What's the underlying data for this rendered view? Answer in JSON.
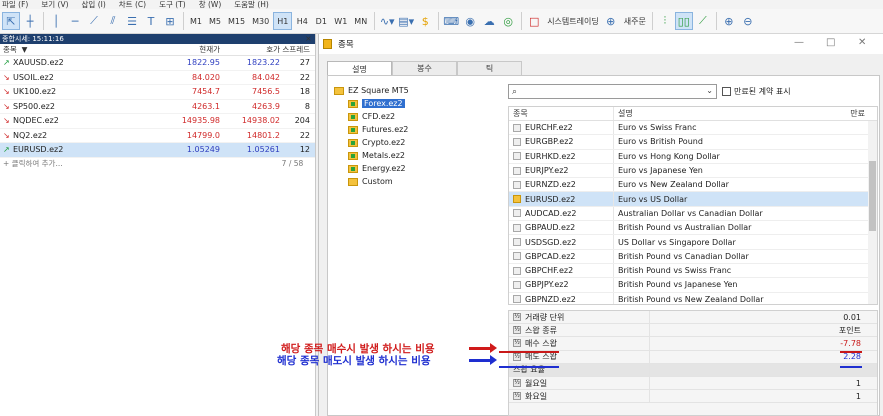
{
  "menu": [
    "파일 (F)",
    "보기 (V)",
    "삽입 (I)",
    "차트 (C)",
    "도구 (T)",
    "창 (W)",
    "도움말 (H)"
  ],
  "toolbar": {
    "timeframes": [
      "M1",
      "M5",
      "M15",
      "M30",
      "H1",
      "H4",
      "D1",
      "W1",
      "MN"
    ],
    "active_timeframe": "H1",
    "algo_trading_label": "시스템트레이딩",
    "new_order_label": "새주문"
  },
  "market_watch": {
    "title": "종합시세: 15:11:16",
    "columns": [
      "종목",
      "현재가",
      "호가",
      "스프레드"
    ],
    "rows": [
      {
        "symbol": "XAUUSD.ez2",
        "dir": "up",
        "bid": "1822.95",
        "ask": "1823.22",
        "spread": "27",
        "bid_color": "blue",
        "ask_color": "blue"
      },
      {
        "symbol": "USOIL.ez2",
        "dir": "down",
        "bid": "84.020",
        "ask": "84.042",
        "spread": "22",
        "bid_color": "red",
        "ask_color": "red"
      },
      {
        "symbol": "UK100.ez2",
        "dir": "down",
        "bid": "7454.7",
        "ask": "7456.5",
        "spread": "18",
        "bid_color": "red",
        "ask_color": "red"
      },
      {
        "symbol": "SP500.ez2",
        "dir": "down",
        "bid": "4263.1",
        "ask": "4263.9",
        "spread": "8",
        "bid_color": "red",
        "ask_color": "red"
      },
      {
        "symbol": "NQDEC.ez2",
        "dir": "down",
        "bid": "14935.98",
        "ask": "14938.02",
        "spread": "204",
        "bid_color": "red",
        "ask_color": "red"
      },
      {
        "symbol": "NQ2.ez2",
        "dir": "down",
        "bid": "14799.0",
        "ask": "14801.2",
        "spread": "22",
        "bid_color": "red",
        "ask_color": "red"
      },
      {
        "symbol": "EURUSD.ez2",
        "dir": "up",
        "bid": "1.05249",
        "ask": "1.05261",
        "spread": "12",
        "bid_color": "blue",
        "ask_color": "blue"
      }
    ],
    "add_label": "클릭하여 추가...",
    "count": "7 / 58"
  },
  "dialog": {
    "title": "종목",
    "tabs": [
      "설명",
      "봉수",
      "틱"
    ],
    "active_tab": "설명",
    "tree": {
      "root": "EZ Square MT5",
      "children": [
        "Forex.ez2",
        "CFD.ez2",
        "Futures.ez2",
        "Crypto.ez2",
        "Metals.ez2",
        "Energy.ez2",
        "Custom"
      ],
      "selected": "Forex.ez2"
    },
    "search_value": "",
    "checkbox_label": "만료된 계약 표시",
    "list_columns": [
      "종목",
      "설명",
      "만료"
    ],
    "list_rows": [
      {
        "symbol": "EURCHF.ez2",
        "desc": "Euro vs Swiss Franc"
      },
      {
        "symbol": "EURGBP.ez2",
        "desc": "Euro vs British Pound"
      },
      {
        "symbol": "EURHKD.ez2",
        "desc": "Euro vs Hong Kong Dollar"
      },
      {
        "symbol": "EURJPY.ez2",
        "desc": "Euro vs Japanese Yen"
      },
      {
        "symbol": "EURNZD.ez2",
        "desc": "Euro vs New Zealand Dollar"
      },
      {
        "symbol": "EURUSD.ez2",
        "desc": "Euro vs US Dollar",
        "selected": true
      },
      {
        "symbol": "AUDCAD.ez2",
        "desc": "Australian Dollar vs Canadian Dollar"
      },
      {
        "symbol": "GBPAUD.ez2",
        "desc": "British Pound vs Australian Dollar"
      },
      {
        "symbol": "USDSGD.ez2",
        "desc": "US Dollar vs Singapore Dollar"
      },
      {
        "symbol": "GBPCAD.ez2",
        "desc": "British Pound vs Canadian Dollar"
      },
      {
        "symbol": "GBPCHF.ez2",
        "desc": "British Pound vs Swiss Franc"
      },
      {
        "symbol": "GBPJPY.ez2",
        "desc": "British Pound vs Japanese Yen"
      },
      {
        "symbol": "GBPNZD.ez2",
        "desc": "British Pound vs New Zealand Dollar"
      }
    ],
    "props": [
      {
        "key": "거래량 단위",
        "value": "0.01"
      },
      {
        "key": "스왑 종류",
        "value": "포인트"
      },
      {
        "key": "매수 스왑",
        "value": "-7.78"
      },
      {
        "key": "매도 스왑",
        "value": "2.28"
      },
      {
        "key": "스왑 요율",
        "value": "",
        "header": true
      },
      {
        "key": "월요일",
        "value": "1"
      },
      {
        "key": "화요일",
        "value": "1"
      }
    ]
  },
  "annotations": {
    "buy": "해당 종목 매수시 발생 하시는 비용",
    "sell": "해당 종목 매도시 발생 하시는 비용",
    "buy_color": "#d01a1a",
    "sell_color": "#1e2ed0"
  }
}
